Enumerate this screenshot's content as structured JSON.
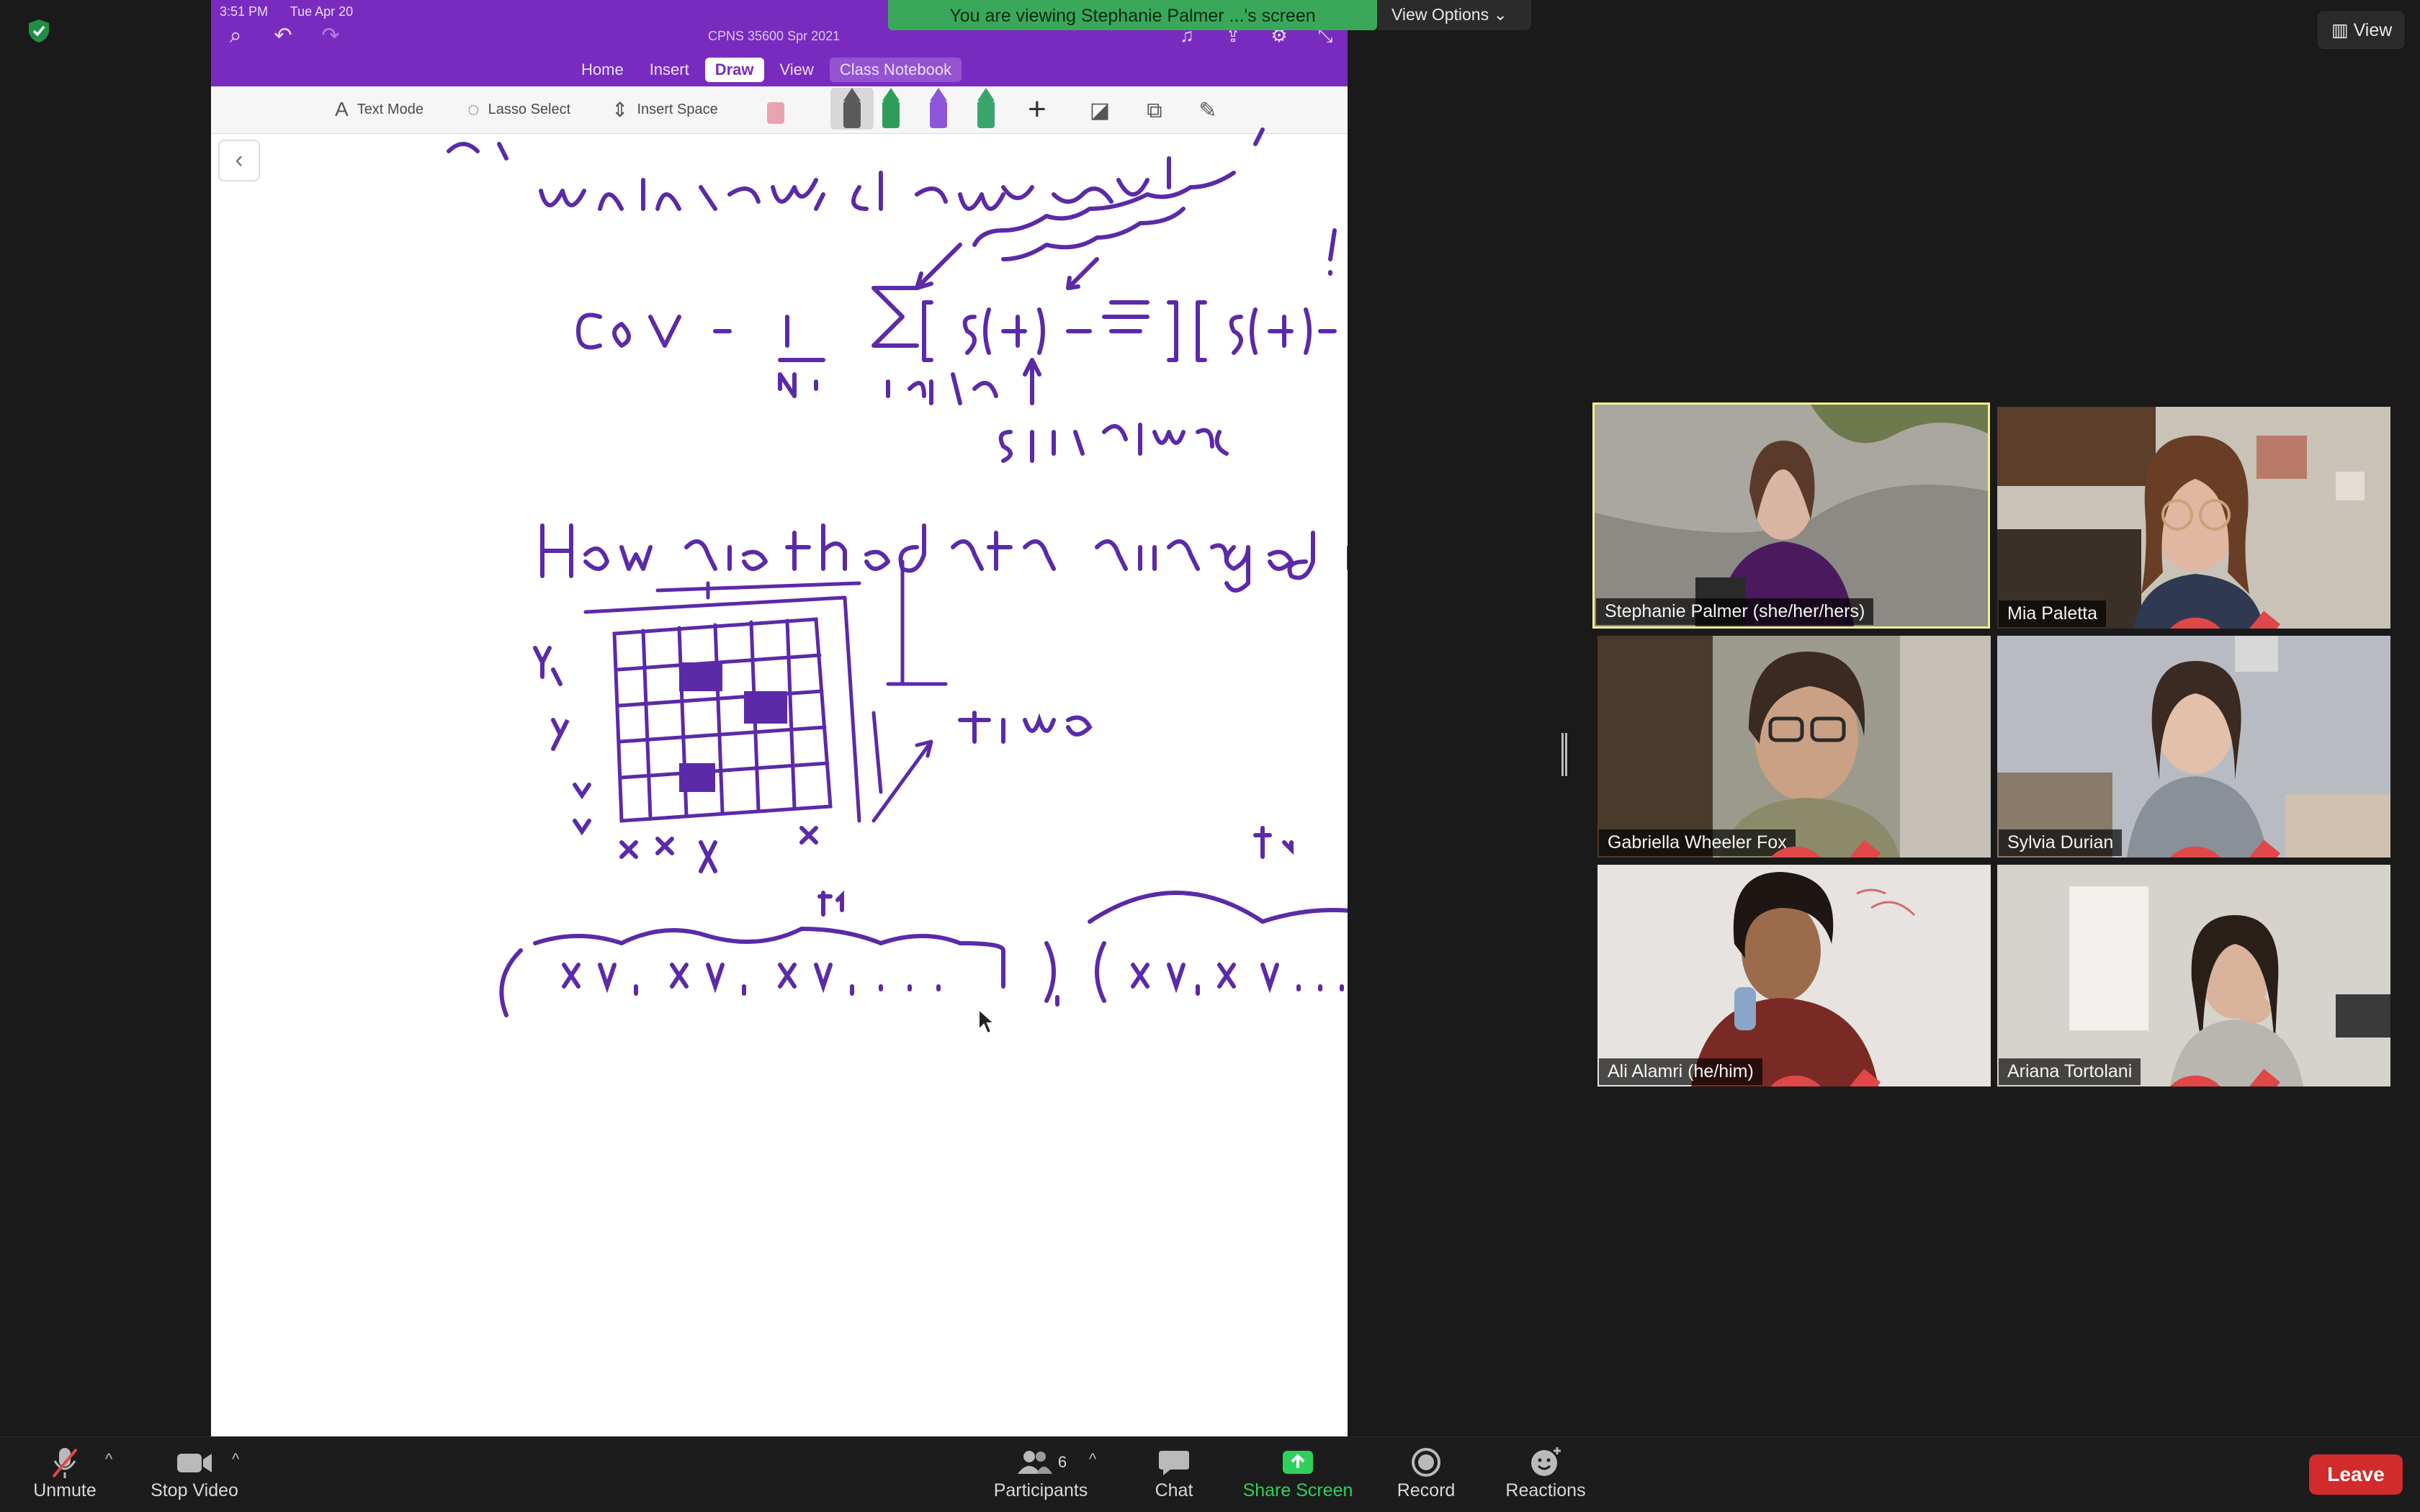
{
  "banner": {
    "viewing_text": "You are viewing Stephanie Palmer ...'s screen",
    "view_options_label": "View Options",
    "view_label": "View"
  },
  "onenote": {
    "time": "3:51 PM",
    "date": "Tue Apr 20",
    "notebook_title": "CPNS 35600 Spr 2021",
    "tabs": [
      "Home",
      "Insert",
      "Draw",
      "View",
      "Class Notebook"
    ],
    "active_tab": "Draw",
    "tools": {
      "text_mode": "Text Mode",
      "lasso_select": "Lasso Select",
      "insert_space": "Insert Space"
    },
    "pen_colors": [
      "#5a5a5a",
      "#2f9d5a",
      "#8f55d9",
      "#3aa56a"
    ]
  },
  "participants": [
    {
      "name": "Stephanie Palmer (she/her/hers)",
      "muted": false,
      "speaking": true
    },
    {
      "name": "Mia Paletta",
      "muted": true,
      "speaking": false
    },
    {
      "name": "Gabriella Wheeler Fox",
      "muted": true,
      "speaking": false
    },
    {
      "name": "Sylvia Durian",
      "muted": true,
      "speaking": false
    },
    {
      "name": "Ali Alamri (he/him)",
      "muted": true,
      "speaking": false
    },
    {
      "name": "Ariana Tortolani",
      "muted": true,
      "speaking": false
    }
  ],
  "controls": {
    "unmute": "Unmute",
    "stop_video": "Stop Video",
    "participants": "Participants",
    "participants_count": "6",
    "chat": "Chat",
    "share_screen": "Share Screen",
    "record": "Record",
    "reactions": "Reactions",
    "leave": "Leave"
  },
  "colors": {
    "onenote_purple": "#7a2bbf",
    "ink_purple": "#5b2aa8",
    "banner_green": "#3aa85a",
    "share_green": "#2fd05a",
    "leave_red": "#d12b2b",
    "speaker_outline": "#f3f08f"
  }
}
